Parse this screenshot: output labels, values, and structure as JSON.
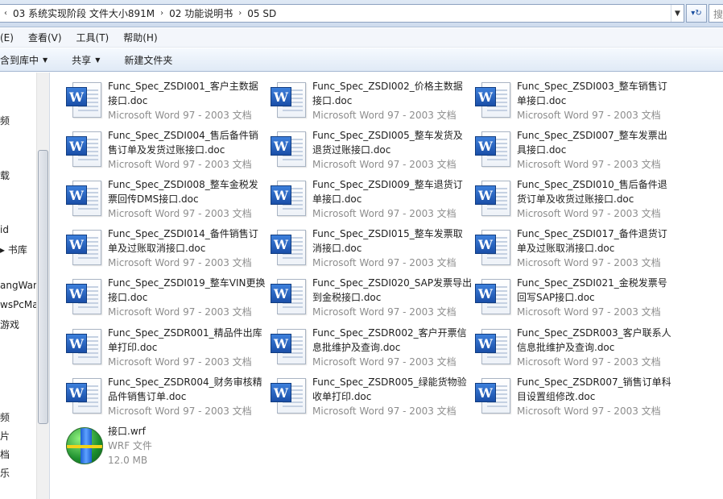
{
  "address_bar": {
    "segments": [
      "03 系统实现阶段 文件大小891M",
      "02 功能说明书",
      "05 SD"
    ],
    "search_placeholder": "搜"
  },
  "menu": [
    "(E)",
    "查看(V)",
    "工具(T)",
    "帮助(H)"
  ],
  "toolbar": {
    "include_library": "含到库中",
    "share": "共享",
    "new_folder": "新建文件夹"
  },
  "nav_pane": [
    "频",
    "载",
    "id",
    "书库",
    "angWang",
    "wsPcMa",
    "游戏",
    "频",
    "片",
    "档",
    "乐"
  ],
  "files": [
    {
      "name1": "Func_Spec_ZSDI001_客户主数据",
      "name2": "接口.doc",
      "meta1": "Microsoft Word 97 - 2003 文档",
      "meta2": ""
    },
    {
      "name1": "Func_Spec_ZSDI002_价格主数据",
      "name2": "接口.doc",
      "meta1": "Microsoft Word 97 - 2003 文档",
      "meta2": ""
    },
    {
      "name1": "Func_Spec_ZSDI003_整车销售订",
      "name2": "单接口.doc",
      "meta1": "Microsoft Word 97 - 2003 文档",
      "meta2": ""
    },
    {
      "name1": "Func_Spec_ZSDI004_售后备件销",
      "name2": "售订单及发货过账接口.doc",
      "meta1": "Microsoft Word 97 - 2003 文档",
      "meta2": ""
    },
    {
      "name1": "Func_Spec_ZSDI005_整车发货及",
      "name2": "退货过账接口.doc",
      "meta1": "Microsoft Word 97 - 2003 文档",
      "meta2": ""
    },
    {
      "name1": "Func_Spec_ZSDI007_整车发票出",
      "name2": "具接口.doc",
      "meta1": "Microsoft Word 97 - 2003 文档",
      "meta2": ""
    },
    {
      "name1": "Func_Spec_ZSDI008_整车金税发",
      "name2": "票回传DMS接口.doc",
      "meta1": "Microsoft Word 97 - 2003 文档",
      "meta2": ""
    },
    {
      "name1": "Func_Spec_ZSDI009_整车退货订",
      "name2": "单接口.doc",
      "meta1": "Microsoft Word 97 - 2003 文档",
      "meta2": ""
    },
    {
      "name1": "Func_Spec_ZSDI010_售后备件退",
      "name2": "货订单及收货过账接口.doc",
      "meta1": "Microsoft Word 97 - 2003 文档",
      "meta2": ""
    },
    {
      "name1": "Func_Spec_ZSDI014_备件销售订",
      "name2": "单及过账取消接口.doc",
      "meta1": "Microsoft Word 97 - 2003 文档",
      "meta2": ""
    },
    {
      "name1": "Func_Spec_ZSDI015_整车发票取",
      "name2": "消接口.doc",
      "meta1": "Microsoft Word 97 - 2003 文档",
      "meta2": ""
    },
    {
      "name1": "Func_Spec_ZSDI017_备件退货订",
      "name2": "单及过账取消接口.doc",
      "meta1": "Microsoft Word 97 - 2003 文档",
      "meta2": ""
    },
    {
      "name1": "Func_Spec_ZSDI019_整车VIN更换",
      "name2": "接口.doc",
      "meta1": "Microsoft Word 97 - 2003 文档",
      "meta2": ""
    },
    {
      "name1": "Func_Spec_ZSDI020_SAP发票导出",
      "name2": "到金税接口.doc",
      "meta1": "Microsoft Word 97 - 2003 文档",
      "meta2": ""
    },
    {
      "name1": "Func_Spec_ZSDI021_金税发票号",
      "name2": "回写SAP接口.doc",
      "meta1": "Microsoft Word 97 - 2003 文档",
      "meta2": ""
    },
    {
      "name1": "Func_Spec_ZSDR001_精品件出库",
      "name2": "单打印.doc",
      "meta1": "Microsoft Word 97 - 2003 文档",
      "meta2": ""
    },
    {
      "name1": "Func_Spec_ZSDR002_客户开票信",
      "name2": "息批维护及查询.doc",
      "meta1": "Microsoft Word 97 - 2003 文档",
      "meta2": ""
    },
    {
      "name1": "Func_Spec_ZSDR003_客户联系人",
      "name2": "信息批维护及查询.doc",
      "meta1": "Microsoft Word 97 - 2003 文档",
      "meta2": ""
    },
    {
      "name1": "Func_Spec_ZSDR004_财务审核精",
      "name2": "品件销售订单.doc",
      "meta1": "Microsoft Word 97 - 2003 文档",
      "meta2": ""
    },
    {
      "name1": "Func_Spec_ZSDR005_绿能货物验",
      "name2": "收单打印.doc",
      "meta1": "Microsoft Word 97 - 2003 文档",
      "meta2": ""
    },
    {
      "name1": "Func_Spec_ZSDR007_销售订单科",
      "name2": "目设置组修改.doc",
      "meta1": "Microsoft Word 97 - 2003 文档",
      "meta2": ""
    },
    {
      "name1": "接口.wrf",
      "name2": "",
      "meta1": "WRF 文件",
      "meta2": "12.0 MB",
      "icon": "wrf-globe-icon"
    }
  ]
}
